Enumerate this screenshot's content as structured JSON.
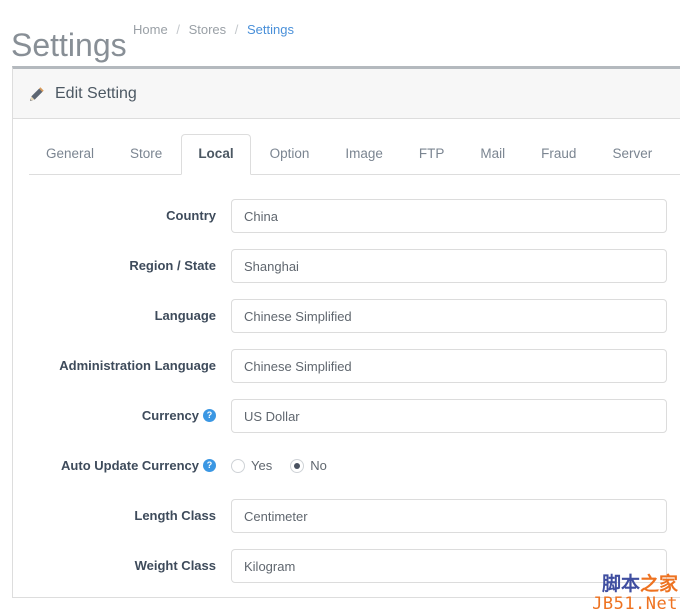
{
  "header": {
    "title": "Settings",
    "breadcrumb": [
      {
        "label": "Home",
        "active": false
      },
      {
        "label": "Stores",
        "active": false
      },
      {
        "label": "Settings",
        "active": true
      }
    ],
    "separator": "/"
  },
  "panel": {
    "title": "Edit Setting",
    "icon": "pencil-icon"
  },
  "tabs": [
    {
      "label": "General",
      "active": false
    },
    {
      "label": "Store",
      "active": false
    },
    {
      "label": "Local",
      "active": true
    },
    {
      "label": "Option",
      "active": false
    },
    {
      "label": "Image",
      "active": false
    },
    {
      "label": "FTP",
      "active": false
    },
    {
      "label": "Mail",
      "active": false
    },
    {
      "label": "Fraud",
      "active": false
    },
    {
      "label": "Server",
      "active": false
    }
  ],
  "form": {
    "fields": [
      {
        "label": "Country",
        "value": "China",
        "type": "select",
        "help": false
      },
      {
        "label": "Region / State",
        "value": "Shanghai",
        "type": "select",
        "help": false
      },
      {
        "label": "Language",
        "value": "Chinese Simplified",
        "type": "select",
        "help": false
      },
      {
        "label": "Administration Language",
        "value": "Chinese Simplified",
        "type": "select",
        "help": false
      },
      {
        "label": "Currency",
        "value": "US Dollar",
        "type": "select",
        "help": true
      },
      {
        "label": "Auto Update Currency",
        "type": "radio",
        "help": true,
        "options": [
          {
            "label": "Yes",
            "checked": false
          },
          {
            "label": "No",
            "checked": true
          }
        ]
      },
      {
        "label": "Length Class",
        "value": "Centimeter",
        "type": "select",
        "help": false
      },
      {
        "label": "Weight Class",
        "value": "Kilogram",
        "type": "select",
        "help": false
      }
    ],
    "help_glyph": "?"
  },
  "watermark": {
    "cn_part1": "脚本",
    "cn_part2": "之家",
    "en": "JB51.Net"
  },
  "colors": {
    "accent_blue": "#4a90d9",
    "help_blue": "#3b97e3",
    "label_dark": "#3e4b5b",
    "muted": "#9aa0a6",
    "panel_border": "#dddddd",
    "watermark_orange": "#ee7220",
    "watermark_blue": "#3f4ea0"
  }
}
